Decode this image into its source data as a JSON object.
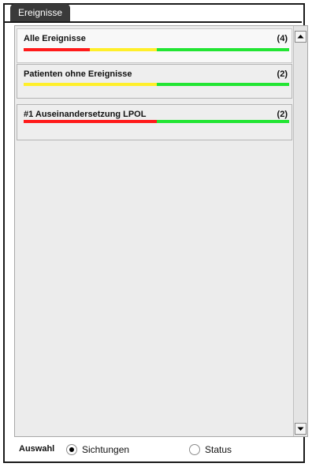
{
  "tab": {
    "label": "Ereignisse"
  },
  "colors": {
    "red": "#ff1a1a",
    "yellow": "#ffef2a",
    "green": "#22e533"
  },
  "items": [
    {
      "label": "Alle Ereignisse",
      "count": "(4)",
      "selected": true,
      "bar": [
        {
          "color": "red",
          "share": 0.25
        },
        {
          "color": "yellow",
          "share": 0.25
        },
        {
          "color": "green",
          "share": 0.5
        }
      ]
    },
    {
      "label": "Patienten ohne Ereignisse",
      "count": "(2)",
      "selected": false,
      "bar": [
        {
          "color": "yellow",
          "share": 0.5
        },
        {
          "color": "green",
          "share": 0.5
        }
      ]
    },
    {
      "label": "#1 Auseinandersetzung LPOL",
      "count": "(2)",
      "selected": false,
      "bar": [
        {
          "color": "red",
          "share": 0.5
        },
        {
          "color": "green",
          "share": 0.5
        }
      ]
    }
  ],
  "footer": {
    "title": "Auswahl",
    "options": [
      {
        "label": "Sichtungen",
        "checked": true
      },
      {
        "label": "Status",
        "checked": false
      }
    ]
  }
}
